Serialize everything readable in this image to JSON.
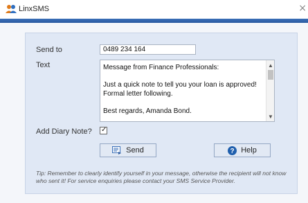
{
  "window": {
    "title": "LinxSMS",
    "icon": "users-icon",
    "close_glyph": "×"
  },
  "form": {
    "send_to_label": "Send to",
    "send_to_value": "0489 234 164",
    "text_label": "Text",
    "message": "Message from Finance Professionals:\n\nJust a quick note to tell you your loan is approved! Formal letter following.\n\nBest regards, Amanda Bond.",
    "diary_label": "Add Diary Note?",
    "diary_checked": true,
    "check_glyph": "✓",
    "scroll_up_glyph": "▲",
    "scroll_down_glyph": "▼"
  },
  "buttons": {
    "send_label": "Send",
    "send_icon": "send-icon",
    "help_label": "Help",
    "help_icon": "help-icon"
  },
  "tip": "Tip: Remember to clearly identify yourself in your message, otherwise the recipient will not know who sent it! For service enquiries please contact your SMS Service Provider.",
  "colors": {
    "accent_bar": "#2b5aa0",
    "panel_bg": "#e0e8f5",
    "help_icon_bg": "#1f5fad"
  }
}
